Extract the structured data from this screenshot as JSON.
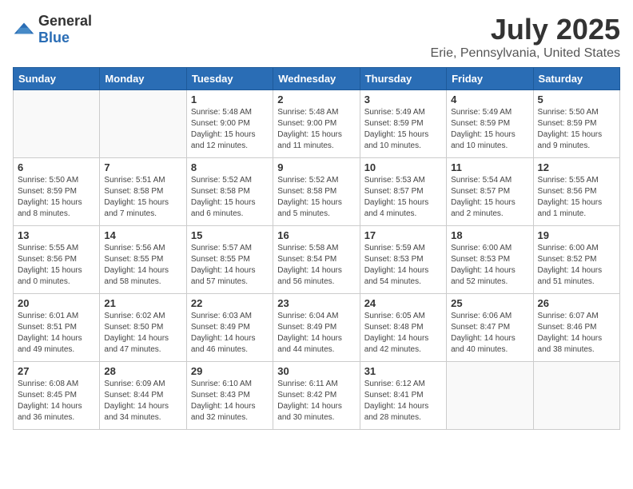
{
  "logo": {
    "text_general": "General",
    "text_blue": "Blue"
  },
  "title": "July 2025",
  "subtitle": "Erie, Pennsylvania, United States",
  "weekdays": [
    "Sunday",
    "Monday",
    "Tuesday",
    "Wednesday",
    "Thursday",
    "Friday",
    "Saturday"
  ],
  "weeks": [
    [
      {
        "day": "",
        "sunrise": "",
        "sunset": "",
        "daylight": ""
      },
      {
        "day": "",
        "sunrise": "",
        "sunset": "",
        "daylight": ""
      },
      {
        "day": "1",
        "sunrise": "Sunrise: 5:48 AM",
        "sunset": "Sunset: 9:00 PM",
        "daylight": "Daylight: 15 hours and 12 minutes."
      },
      {
        "day": "2",
        "sunrise": "Sunrise: 5:48 AM",
        "sunset": "Sunset: 9:00 PM",
        "daylight": "Daylight: 15 hours and 11 minutes."
      },
      {
        "day": "3",
        "sunrise": "Sunrise: 5:49 AM",
        "sunset": "Sunset: 8:59 PM",
        "daylight": "Daylight: 15 hours and 10 minutes."
      },
      {
        "day": "4",
        "sunrise": "Sunrise: 5:49 AM",
        "sunset": "Sunset: 8:59 PM",
        "daylight": "Daylight: 15 hours and 10 minutes."
      },
      {
        "day": "5",
        "sunrise": "Sunrise: 5:50 AM",
        "sunset": "Sunset: 8:59 PM",
        "daylight": "Daylight: 15 hours and 9 minutes."
      }
    ],
    [
      {
        "day": "6",
        "sunrise": "Sunrise: 5:50 AM",
        "sunset": "Sunset: 8:59 PM",
        "daylight": "Daylight: 15 hours and 8 minutes."
      },
      {
        "day": "7",
        "sunrise": "Sunrise: 5:51 AM",
        "sunset": "Sunset: 8:58 PM",
        "daylight": "Daylight: 15 hours and 7 minutes."
      },
      {
        "day": "8",
        "sunrise": "Sunrise: 5:52 AM",
        "sunset": "Sunset: 8:58 PM",
        "daylight": "Daylight: 15 hours and 6 minutes."
      },
      {
        "day": "9",
        "sunrise": "Sunrise: 5:52 AM",
        "sunset": "Sunset: 8:58 PM",
        "daylight": "Daylight: 15 hours and 5 minutes."
      },
      {
        "day": "10",
        "sunrise": "Sunrise: 5:53 AM",
        "sunset": "Sunset: 8:57 PM",
        "daylight": "Daylight: 15 hours and 4 minutes."
      },
      {
        "day": "11",
        "sunrise": "Sunrise: 5:54 AM",
        "sunset": "Sunset: 8:57 PM",
        "daylight": "Daylight: 15 hours and 2 minutes."
      },
      {
        "day": "12",
        "sunrise": "Sunrise: 5:55 AM",
        "sunset": "Sunset: 8:56 PM",
        "daylight": "Daylight: 15 hours and 1 minute."
      }
    ],
    [
      {
        "day": "13",
        "sunrise": "Sunrise: 5:55 AM",
        "sunset": "Sunset: 8:56 PM",
        "daylight": "Daylight: 15 hours and 0 minutes."
      },
      {
        "day": "14",
        "sunrise": "Sunrise: 5:56 AM",
        "sunset": "Sunset: 8:55 PM",
        "daylight": "Daylight: 14 hours and 58 minutes."
      },
      {
        "day": "15",
        "sunrise": "Sunrise: 5:57 AM",
        "sunset": "Sunset: 8:55 PM",
        "daylight": "Daylight: 14 hours and 57 minutes."
      },
      {
        "day": "16",
        "sunrise": "Sunrise: 5:58 AM",
        "sunset": "Sunset: 8:54 PM",
        "daylight": "Daylight: 14 hours and 56 minutes."
      },
      {
        "day": "17",
        "sunrise": "Sunrise: 5:59 AM",
        "sunset": "Sunset: 8:53 PM",
        "daylight": "Daylight: 14 hours and 54 minutes."
      },
      {
        "day": "18",
        "sunrise": "Sunrise: 6:00 AM",
        "sunset": "Sunset: 8:53 PM",
        "daylight": "Daylight: 14 hours and 52 minutes."
      },
      {
        "day": "19",
        "sunrise": "Sunrise: 6:00 AM",
        "sunset": "Sunset: 8:52 PM",
        "daylight": "Daylight: 14 hours and 51 minutes."
      }
    ],
    [
      {
        "day": "20",
        "sunrise": "Sunrise: 6:01 AM",
        "sunset": "Sunset: 8:51 PM",
        "daylight": "Daylight: 14 hours and 49 minutes."
      },
      {
        "day": "21",
        "sunrise": "Sunrise: 6:02 AM",
        "sunset": "Sunset: 8:50 PM",
        "daylight": "Daylight: 14 hours and 47 minutes."
      },
      {
        "day": "22",
        "sunrise": "Sunrise: 6:03 AM",
        "sunset": "Sunset: 8:49 PM",
        "daylight": "Daylight: 14 hours and 46 minutes."
      },
      {
        "day": "23",
        "sunrise": "Sunrise: 6:04 AM",
        "sunset": "Sunset: 8:49 PM",
        "daylight": "Daylight: 14 hours and 44 minutes."
      },
      {
        "day": "24",
        "sunrise": "Sunrise: 6:05 AM",
        "sunset": "Sunset: 8:48 PM",
        "daylight": "Daylight: 14 hours and 42 minutes."
      },
      {
        "day": "25",
        "sunrise": "Sunrise: 6:06 AM",
        "sunset": "Sunset: 8:47 PM",
        "daylight": "Daylight: 14 hours and 40 minutes."
      },
      {
        "day": "26",
        "sunrise": "Sunrise: 6:07 AM",
        "sunset": "Sunset: 8:46 PM",
        "daylight": "Daylight: 14 hours and 38 minutes."
      }
    ],
    [
      {
        "day": "27",
        "sunrise": "Sunrise: 6:08 AM",
        "sunset": "Sunset: 8:45 PM",
        "daylight": "Daylight: 14 hours and 36 minutes."
      },
      {
        "day": "28",
        "sunrise": "Sunrise: 6:09 AM",
        "sunset": "Sunset: 8:44 PM",
        "daylight": "Daylight: 14 hours and 34 minutes."
      },
      {
        "day": "29",
        "sunrise": "Sunrise: 6:10 AM",
        "sunset": "Sunset: 8:43 PM",
        "daylight": "Daylight: 14 hours and 32 minutes."
      },
      {
        "day": "30",
        "sunrise": "Sunrise: 6:11 AM",
        "sunset": "Sunset: 8:42 PM",
        "daylight": "Daylight: 14 hours and 30 minutes."
      },
      {
        "day": "31",
        "sunrise": "Sunrise: 6:12 AM",
        "sunset": "Sunset: 8:41 PM",
        "daylight": "Daylight: 14 hours and 28 minutes."
      },
      {
        "day": "",
        "sunrise": "",
        "sunset": "",
        "daylight": ""
      },
      {
        "day": "",
        "sunrise": "",
        "sunset": "",
        "daylight": ""
      }
    ]
  ]
}
